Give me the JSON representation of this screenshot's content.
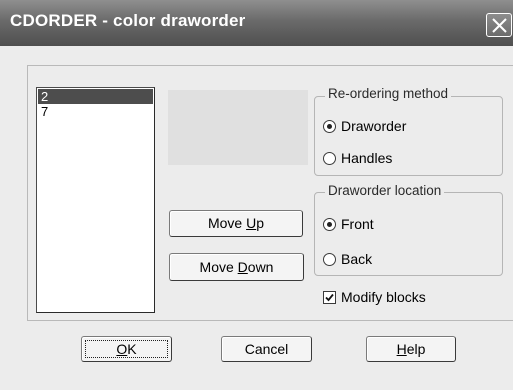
{
  "window": {
    "title": "CDORDER - color draworder",
    "close_icon": "close-icon"
  },
  "color_list": {
    "items": [
      {
        "label": "2",
        "selected": true
      },
      {
        "label": "7",
        "selected": false
      }
    ]
  },
  "buttons": {
    "move_up": {
      "prefix": "Move ",
      "accel": "U",
      "suffix": "p"
    },
    "move_down": {
      "prefix": "Move ",
      "accel": "D",
      "suffix": "own"
    },
    "ok": {
      "prefix": "",
      "accel": "O",
      "suffix": "K"
    },
    "cancel": {
      "label": "Cancel"
    },
    "help": {
      "prefix": "",
      "accel": "H",
      "suffix": "elp"
    }
  },
  "reordering_method": {
    "legend": "Re-ordering method",
    "options": [
      {
        "label": "Draworder",
        "checked": true
      },
      {
        "label": "Handles",
        "checked": false
      }
    ]
  },
  "draworder_location": {
    "legend": "Draworder location",
    "options": [
      {
        "label": "Front",
        "checked": true
      },
      {
        "label": "Back",
        "checked": false
      }
    ]
  },
  "modify_blocks": {
    "label": "Modify blocks",
    "checked": true
  },
  "colors": {
    "titlebar": "#6a6a6a",
    "dialog_bg": "#ececec",
    "selection": "#4d4d4d"
  }
}
